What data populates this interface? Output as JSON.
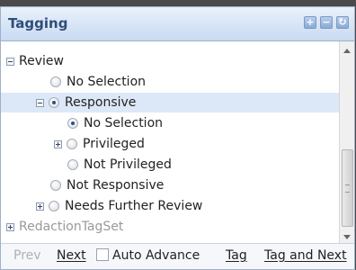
{
  "header": {
    "title": "Tagging",
    "buttons": [
      "+",
      "−",
      "↻"
    ]
  },
  "tree": {
    "review": "Review",
    "no_selection_1": "No Selection",
    "responsive": "Responsive",
    "no_selection_2": "No Selection",
    "privileged": "Privileged",
    "not_privileged": "Not Privileged",
    "not_responsive": "Not Responsive",
    "needs_further_review": "Needs Further Review",
    "redaction_tag_set": "RedactionTagSet"
  },
  "footer": {
    "prev": "Prev",
    "next": "Next",
    "auto_advance": "Auto Advance",
    "tag": "Tag",
    "tag_and_next": "Tag and Next"
  }
}
